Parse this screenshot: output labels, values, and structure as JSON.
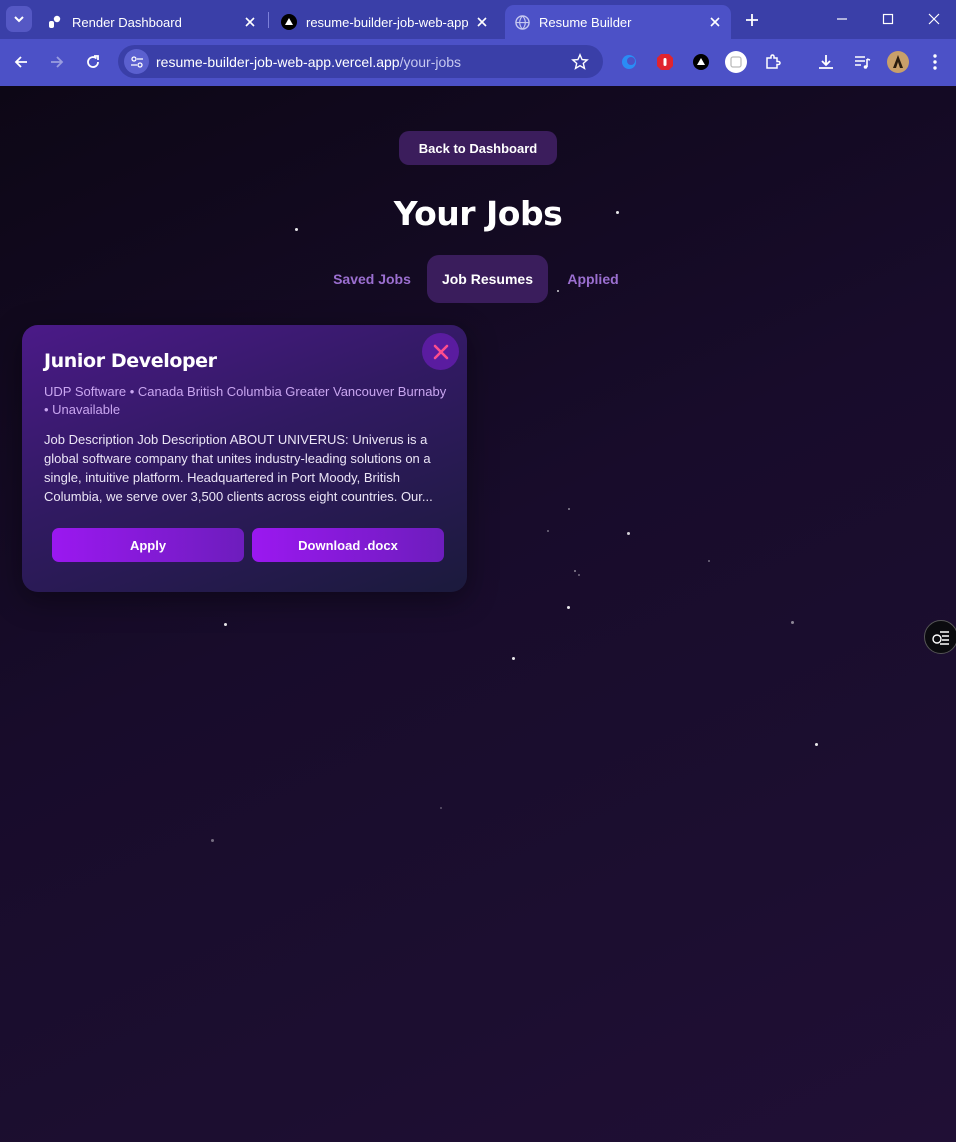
{
  "browser": {
    "tabs": [
      {
        "title": "Render Dashboard",
        "icon": "render-icon"
      },
      {
        "title": "resume-builder-job-web-app -",
        "icon": "vercel-icon"
      },
      {
        "title": "Resume Builder",
        "icon": "globe-icon",
        "active": true
      }
    ],
    "url_host": "resume-builder-job-web-app.vercel.app",
    "url_path": "/your-jobs"
  },
  "page": {
    "back_label": "Back to Dashboard",
    "title": "Your Jobs",
    "tabs": [
      {
        "label": "Saved Jobs"
      },
      {
        "label": "Job Resumes",
        "active": true
      },
      {
        "label": "Applied"
      }
    ]
  },
  "job_card": {
    "title": "Junior Developer",
    "meta": "UDP Software • Canada British Columbia Greater Vancouver Burnaby • Unavailable",
    "description": "Job Description Job Description ABOUT UNIVERUS: Univerus is a global software company that unites industry-leading solutions on a single, intuitive platform. Headquartered in Port Moody, British Columbia, we serve over 3,500 clients across eight countries. Our...",
    "apply_label": "Apply",
    "download_label": "Download .docx"
  },
  "colors": {
    "accent": "#9b18f0",
    "chrome": "#4c51c7",
    "close_x": "#ff4d8d"
  }
}
